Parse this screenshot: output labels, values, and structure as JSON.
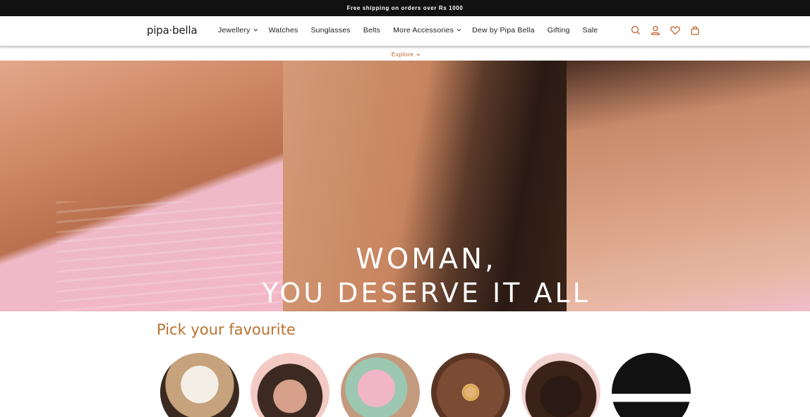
{
  "announcement": {
    "text": "Free shipping on orders over Rs 1000"
  },
  "header": {
    "logo": "pipa·bella",
    "nav": [
      {
        "label": "Jewellery",
        "has_dropdown": true
      },
      {
        "label": "Watches",
        "has_dropdown": false
      },
      {
        "label": "Sunglasses",
        "has_dropdown": false
      },
      {
        "label": "Belts",
        "has_dropdown": false
      },
      {
        "label": "More Accessories",
        "has_dropdown": true
      },
      {
        "label": "Dew by Pipa Bella",
        "has_dropdown": false
      },
      {
        "label": "Gifting",
        "has_dropdown": false
      },
      {
        "label": "Sale",
        "has_dropdown": false
      }
    ],
    "icons": [
      "search-icon",
      "account-icon",
      "wishlist-icon",
      "cart-icon"
    ],
    "icon_color": "#c0612b"
  },
  "explore": {
    "label": "Explore"
  },
  "hero": {
    "line1": "WOMAN,",
    "line2": "YOU DESERVE IT ALL"
  },
  "favourites": {
    "title": "Pick your favourite",
    "title_color": "#b8712f",
    "items": [
      {
        "image": "hat-model"
      },
      {
        "image": "sunglasses-model"
      },
      {
        "image": "scarf-model"
      },
      {
        "image": "earrings-model"
      },
      {
        "image": "hairclip-model"
      },
      {
        "image": "belt-model"
      }
    ]
  },
  "colors": {
    "accent": "#c0612b",
    "announcement_bg": "#111111"
  }
}
